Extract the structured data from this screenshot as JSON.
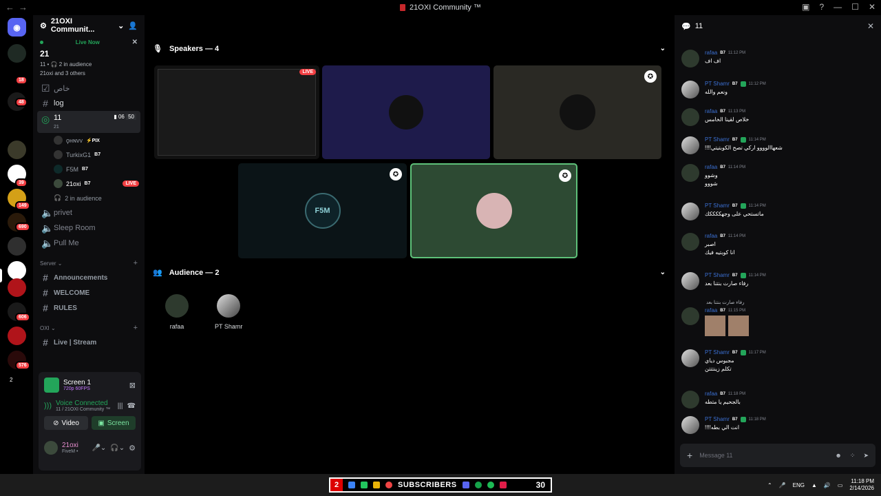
{
  "window": {
    "title": "21OXI Community ™"
  },
  "rail": {
    "badges": [
      "18",
      "48",
      "39",
      "149",
      "690",
      "606",
      "576"
    ],
    "bottom_label": "2"
  },
  "guild": {
    "name": "21OXI Communit..."
  },
  "live_now": {
    "label": "Live Now",
    "channel": "21",
    "audience": "11 • 🎧 2 in audience",
    "others": "21oxi and 3 others"
  },
  "channels": {
    "khas": "خاص",
    "log": "log",
    "stage_name": "11",
    "stage_sub": "21",
    "stage_count_a": "06",
    "stage_count_b": "50",
    "users": [
      {
        "name": "ϙнɴvv",
        "tag": "⚡PIX"
      },
      {
        "name": "TurkixG1",
        "tag": "B7"
      },
      {
        "name": "F5M",
        "tag": "B7"
      },
      {
        "name": "21oxi",
        "tag": "B7",
        "live": "LIVE"
      }
    ],
    "in_audience": "2 in audience",
    "privet": "privet",
    "sleep": "Sleep Room",
    "pull": "Pull Me",
    "cat_server": "Server",
    "announcements": "Announcements",
    "welcome": "WELCOME",
    "rules": "RULES",
    "cat_oxi": "OXI",
    "live_stream": "Live | Stream"
  },
  "panel": {
    "screen_title": "Screen 1",
    "screen_sub": "720p 60FPS",
    "vc_title": "Voice Connected",
    "vc_sub": "11 / 21OXI Community ™",
    "video": "Video",
    "screen": "Screen",
    "user": "21oxi",
    "status": "FiveM •"
  },
  "stage": {
    "speakers": "Speakers — 4",
    "audience": "Audience — 2",
    "live": "LIVE",
    "f5m": "F5M",
    "audience_members": [
      "rafaa",
      "PT Shamr"
    ]
  },
  "chat": {
    "title": "11",
    "placeholder": "Message 11",
    "messages": [
      {
        "name": "rafaa",
        "time": "11:12 PM",
        "text": "اف اف"
      },
      {
        "name": "PT Shamr",
        "time": "11:12 PM",
        "text": "ونعم والله"
      },
      {
        "name": "rafaa",
        "time": "11:13 PM",
        "text": "خلاص لقينا الخامس"
      },
      {
        "name": "PT Shamr",
        "time": "11:14 PM",
        "text": "شعهاالوووو اركي تصح الكوبتيتي!!!!"
      },
      {
        "name": "rafaa",
        "time": "11:14 PM",
        "text": "وشوو"
      },
      {
        "name": "PT Shamr",
        "time": "11:14 PM",
        "text": "ماتستحي على وجهككككك"
      },
      {
        "name": "rafaa",
        "time": "11:14 PM",
        "text": "اصبر"
      },
      {
        "name": "PT Shamr",
        "time": "11:14 PM",
        "text": "رفاء صارت بنتنا بعد"
      },
      {
        "name": "rafaa",
        "time": "11:15 PM",
        "text": ""
      },
      {
        "name": "PT Shamr",
        "time": "11:17 PM",
        "text": "مجبوس دياي"
      },
      {
        "name": "rafaa",
        "time": "11:18 PM",
        "text": "بالجحيم يا متطه"
      },
      {
        "name": "PT Shamr",
        "time": "11:18 PM",
        "text": "انت الي بطه!!!!"
      }
    ],
    "extra_lines": [
      "شووو",
      "انا كوبتيه فيك",
      "تكلم زينتتتن"
    ],
    "reply_text": "رفاء صارت بنتنا بعد"
  },
  "taskbar": {
    "sub_num": "2",
    "sub_label": "SUBSCRIBERS",
    "sub_count": "30",
    "lang": "ENG",
    "time": "11:18 PM",
    "date": "2/14/2026"
  }
}
